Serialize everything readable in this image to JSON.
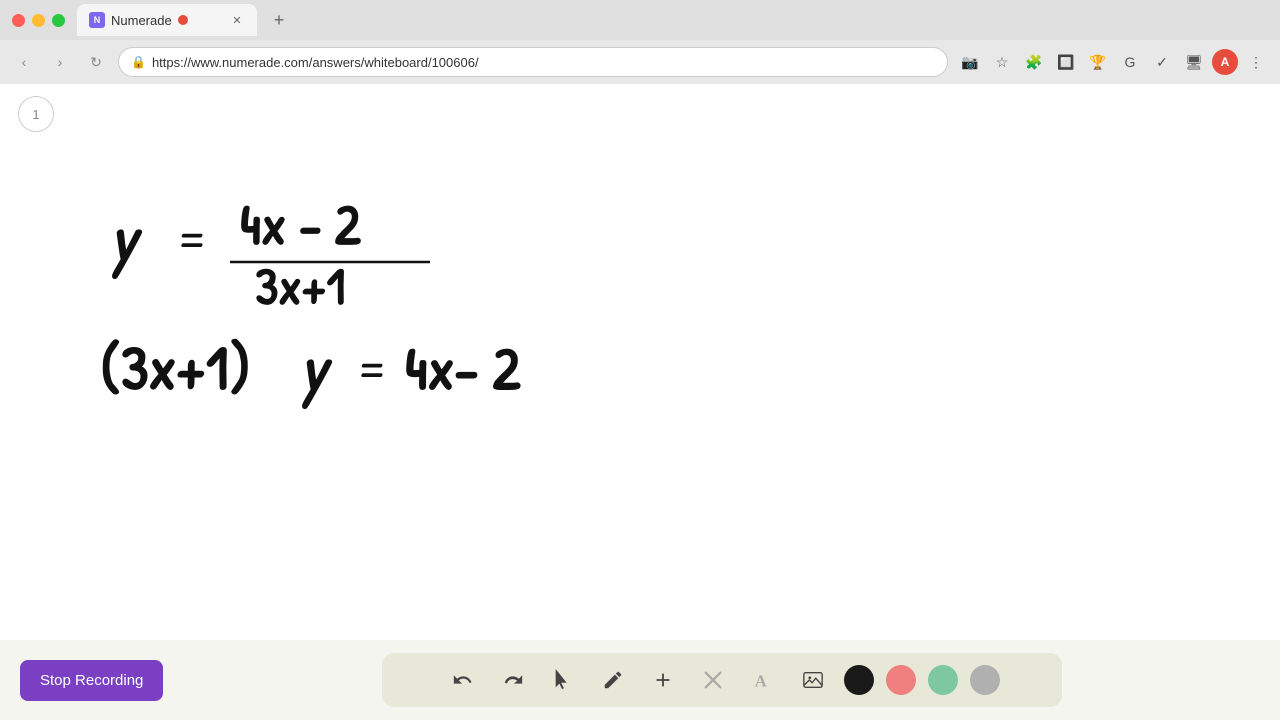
{
  "browser": {
    "tab_title": "Numerade",
    "tab_favicon_text": "N",
    "url": "https://www.numerade.com/answers/whiteboard/100606/",
    "new_tab_label": "+",
    "nav": {
      "back": "‹",
      "forward": "›",
      "reload": "↻"
    }
  },
  "toolbar_right": {
    "icons": [
      "camera",
      "star",
      "extensions",
      "chrome-store",
      "trophy",
      "translate",
      "extensions2",
      "download",
      "profile",
      "menu"
    ]
  },
  "whiteboard": {
    "page_number": "1"
  },
  "bottom_toolbar": {
    "stop_recording_label": "Stop Recording",
    "tools": {
      "undo_label": "↺",
      "redo_label": "↻",
      "select_label": "select",
      "pen_label": "pen",
      "add_label": "+",
      "eraser_label": "eraser",
      "text_label": "A",
      "image_label": "image"
    },
    "colors": {
      "black": "#1a1a1a",
      "pink": "#f08080",
      "green": "#7ec8a0",
      "gray": "#b0b0b0"
    }
  }
}
